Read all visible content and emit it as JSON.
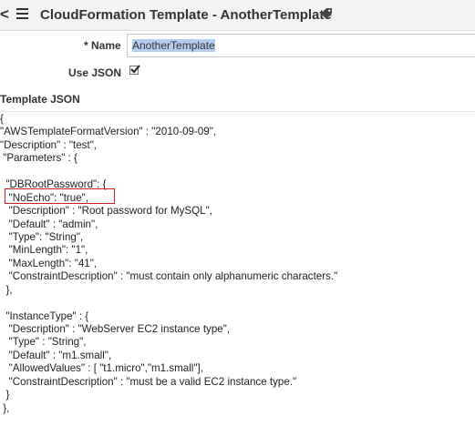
{
  "header": {
    "title": "CloudFormation Template - AnotherTemplate",
    "back_icon": "chevron-left-icon",
    "menu_icon": "hamburger-menu-icon",
    "tag_icon": "tag-icon"
  },
  "form": {
    "name_required_marker": "*",
    "name_label": "Name",
    "name_value": "AnotherTemplate",
    "use_json_label": "Use JSON",
    "use_json_checked": true
  },
  "template_section": {
    "title": "Template JSON",
    "lines": [
      "{",
      "\"AWSTemplateFormatVersion\" : \"2010-09-09\",",
      "\"Description\" : \"test\",",
      " \"Parameters\" : {",
      "",
      "  \"DBRootPassword\": {",
      "   \"NoEcho\": \"true\",",
      "   \"Description\" : \"Root password for MySQL\",",
      "   \"Default\" : \"admin\",",
      "   \"Type\": \"String\",",
      "   \"MinLength\": \"1\",",
      "   \"MaxLength\": \"41\",",
      "   \"ConstraintDescription\" : \"must contain only alphanumeric characters.\"",
      "  },",
      "",
      "  \"InstanceType\" : {",
      "   \"Description\" : \"WebServer EC2 instance type\",",
      "   \"Type\" : \"String\",",
      "   \"Default\" : \"m1.small\",",
      "   \"AllowedValues\" : [ \"t1.micro\",\"m1.small\"],",
      "   \"ConstraintDescription\" : \"must be a valid EC2 instance type.\"",
      "  }",
      " },"
    ]
  },
  "colors": {
    "header_bg": "#f3f3f3",
    "selection": "#b4cdf0",
    "highlight_border": "#d02020"
  }
}
